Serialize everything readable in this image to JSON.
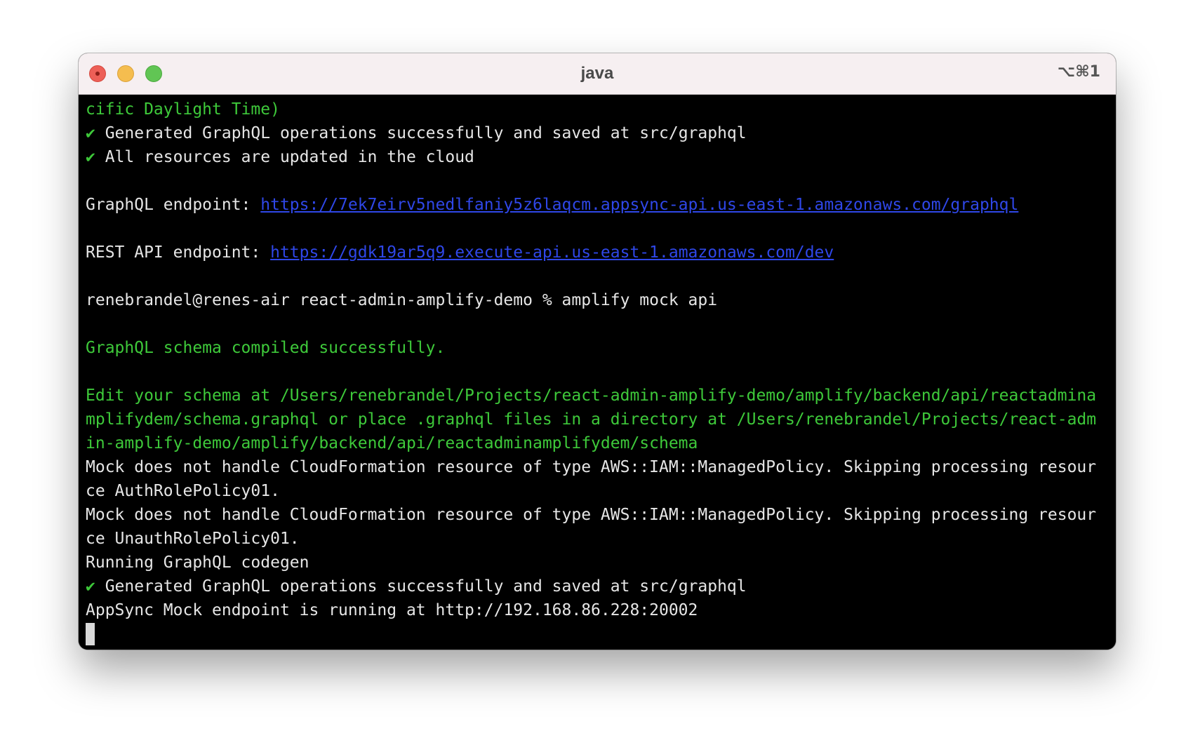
{
  "window": {
    "title": "java",
    "shortcut": "⌥⌘1"
  },
  "colors": {
    "terminal_bg": "#000000",
    "success_green": "#3ec93a",
    "link_blue": "#2f47e8",
    "text": "#e6e6e6"
  },
  "terminal": {
    "line01": "cific Daylight Time)",
    "line02_check": "✔",
    "line02": " Generated GraphQL operations successfully and saved at src/graphql",
    "line03_check": "✔",
    "line03": " All resources are updated in the cloud",
    "graphql_label": "GraphQL endpoint: ",
    "graphql_url": "https://7ek7eirv5nedlfaniy5z6laqcm.appsync-api.us-east-1.amazonaws.com/graphql",
    "rest_label": "REST API endpoint: ",
    "rest_url": "https://gdk19ar5q9.execute-api.us-east-1.amazonaws.com/dev",
    "prompt": "renebrandel@renes-air react-admin-amplify-demo % amplify mock api",
    "schema_compiled": "GraphQL schema compiled successfully.",
    "edit_schema_1": "Edit your schema at /Users/renebrandel/Projects/react-admin-amplify-demo/amplify/backend/api/reactadmina",
    "edit_schema_2": "mplifydem/schema.graphql or place .graphql files in a directory at /Users/renebrandel/Projects/react-adm",
    "edit_schema_3": "in-amplify-demo/amplify/backend/api/reactadminamplifydem/schema",
    "mock_1a": "Mock does not handle CloudFormation resource of type AWS::IAM::ManagedPolicy. Skipping processing resour",
    "mock_1b": "ce AuthRolePolicy01.",
    "mock_2a": "Mock does not handle CloudFormation resource of type AWS::IAM::ManagedPolicy. Skipping processing resour",
    "mock_2b": "ce UnauthRolePolicy01.",
    "codegen": "Running GraphQL codegen",
    "gen_check": "✔",
    "gen_done": " Generated GraphQL operations successfully and saved at src/graphql",
    "appsync": "AppSync Mock endpoint is running at http://192.168.86.228:20002"
  }
}
